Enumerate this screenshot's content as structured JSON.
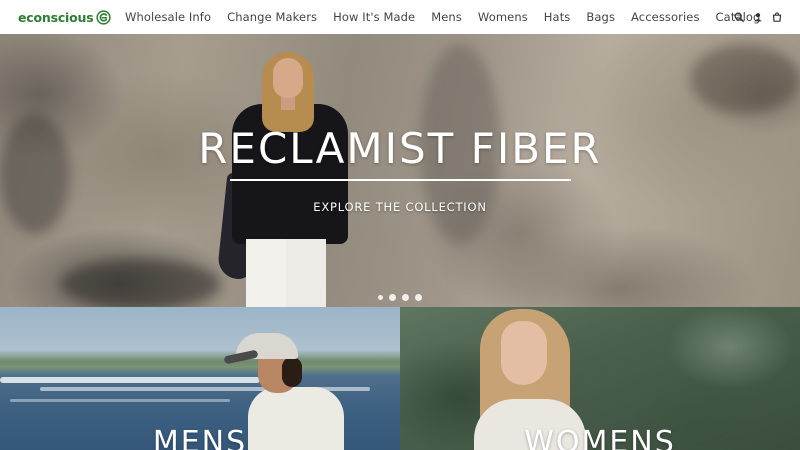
{
  "header": {
    "logo_text": "econscious",
    "nav": [
      {
        "label": "Wholesale Info"
      },
      {
        "label": "Change Makers"
      },
      {
        "label": "How It's Made"
      },
      {
        "label": "Mens"
      },
      {
        "label": "Womens"
      },
      {
        "label": "Hats"
      },
      {
        "label": "Bags"
      },
      {
        "label": "Accessories"
      },
      {
        "label": "Catalog"
      }
    ],
    "icons": [
      "search-icon",
      "account-icon",
      "cart-icon"
    ]
  },
  "hero": {
    "title": "RECLAMIST FIBER",
    "cta": "EXPLORE THE COLLECTION",
    "slide_count": 4,
    "active_slide": 1
  },
  "categories": [
    {
      "label": "MENS"
    },
    {
      "label": "WOMENS"
    }
  ],
  "colors": {
    "brand_green": "#2e7d32",
    "nav_text": "#444444",
    "overlay_text": "#ffffff"
  }
}
